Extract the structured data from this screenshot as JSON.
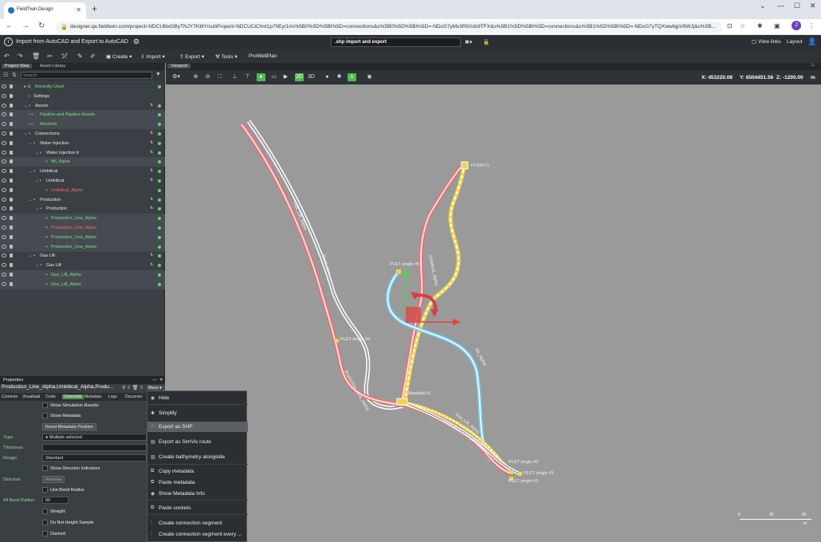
{
  "browser": {
    "tab_title": "FieldTwin Design",
    "url": "designer.qa.fieldtwin.com/project/-NDCU8ixGByTNJY7K8lY/subProject/-NDCUCiChnt1p7hEyr1#s%5B0%5D%5Bt%5D=connections&s%5B0%5D%5Bi%5D=-NDcG7yMx3RlIXds9TFX&s%5B1%5D%5Bt%5D=connections&s%5B1%5D%5Bi%5D=-NDcG7yTQXwwbjpV8WJj&s%5B...",
    "profile_initial": "J"
  },
  "app": {
    "project_name": "Import from AutoCAD and Export to AutoCAD",
    "command_box": ".shp import and export",
    "view_links": "View links",
    "layout": "Layout"
  },
  "toolbar": {
    "create": "Create",
    "import": "Import",
    "export": "Export",
    "tools": "Tools",
    "prowellplan": "ProWellPlan"
  },
  "left_panel": {
    "tab_project_view": "Project View",
    "tab_asset_library": "Asset Library",
    "search_placeholder": "Search",
    "tree": [
      {
        "label": "Recently Used",
        "color": "green"
      },
      {
        "label": "Settings",
        "color": "white"
      },
      {
        "label": "Assets",
        "color": "white"
      },
      {
        "label": "Pipeline and Pipeline Assets",
        "color": "green"
      },
      {
        "label": "Manifold",
        "color": "green"
      },
      {
        "label": "Connections",
        "color": "white"
      },
      {
        "label": "Water Injection",
        "color": "white"
      },
      {
        "label": "Water Injection b",
        "color": "white"
      },
      {
        "label": "WI_Alpha",
        "color": "green"
      },
      {
        "label": "Umbilical",
        "color": "white"
      },
      {
        "label": "Umbilical",
        "color": "white"
      },
      {
        "label": "Umbilical_Alpha",
        "color": "red"
      },
      {
        "label": "Production",
        "color": "white"
      },
      {
        "label": "Production",
        "color": "white"
      },
      {
        "label": "Production_Line_Alpha",
        "color": "green"
      },
      {
        "label": "Production_Line_Alpha",
        "color": "red"
      },
      {
        "label": "Production_Line_Alpha",
        "color": "green"
      },
      {
        "label": "Production_Line_Alpha",
        "color": "green"
      },
      {
        "label": "Gas Lift",
        "color": "white"
      },
      {
        "label": "Gas Lift",
        "color": "white"
      },
      {
        "label": "Gas_Lift_Alpha",
        "color": "green"
      },
      {
        "label": "Gas_Lift_Alpha",
        "color": "green"
      }
    ]
  },
  "properties": {
    "title": "Properties",
    "selection": "Production_Line_Alpha,Umbilical_Alpha,Produ...",
    "more": "More",
    "tabs": [
      "Common",
      "Visualisati",
      "Costs",
      "Connectio",
      "Metadata",
      "Logs",
      "Documen"
    ],
    "show_simulation_results": "Show Simulation Results",
    "show_metadata": "Show Metadata",
    "reset_metadata_position": "Reset Metadata Position",
    "type_label": "Type",
    "type_value": "Multiple selected",
    "thickness_label": "Thickness",
    "design_label": "Design",
    "design_value": "Standard",
    "show_direction_indicators": "Show Direction Indicators",
    "direction_label": "Direction",
    "reverse": "Reverse",
    "use_bend_radius": "Use Bend Radius",
    "all_bend_radius_label": "All Bend Radius",
    "all_bend_radius_value": "50",
    "straight": "Straight",
    "do_not_height_sample": "Do Not Height Sample",
    "dashed": "Dashed"
  },
  "context_menu": {
    "items": [
      "Hide",
      "Simplify",
      "Export as SHP",
      "Export as SimVis route",
      "Create bathymetry alongside",
      "Copy metadata",
      "Paste metadata",
      "Show Metadata Info",
      "Paste sockets",
      "Create connection segment",
      "Create connection segment every ..."
    ]
  },
  "viewport": {
    "tab": "Viewport",
    "x_label": "X:",
    "x_value": "453220.08",
    "y_label": "Y:",
    "y_value": "6504451.56",
    "z_label": "Z:",
    "z_value": "-1200.00",
    "unit": "m",
    "btn_2d": "2D",
    "btn_3d": "3D",
    "labels": {
      "plem1": "PLEM #1",
      "plet5": "PLET single #5",
      "plet4": "PLET single #4",
      "manifold1": "Manifold #1",
      "plet2": "PLET single #2",
      "plet3": "PLET single #3",
      "plet1": "PLET single #1"
    },
    "line_labels": {
      "gas_lift_alpha": "Gas_Lift_Alpha",
      "production_1": "Production",
      "umbilical": "Umbilical_Alpha",
      "wi_alpha": "WI_Alpha",
      "production_2": "Production_Line_Alpha",
      "gas_lift_2": "Gas_Lift_Alpha",
      "production_3": "Production_Line_Alpha"
    },
    "scale": [
      "0",
      "40",
      "80"
    ],
    "scale_unit": "m"
  }
}
